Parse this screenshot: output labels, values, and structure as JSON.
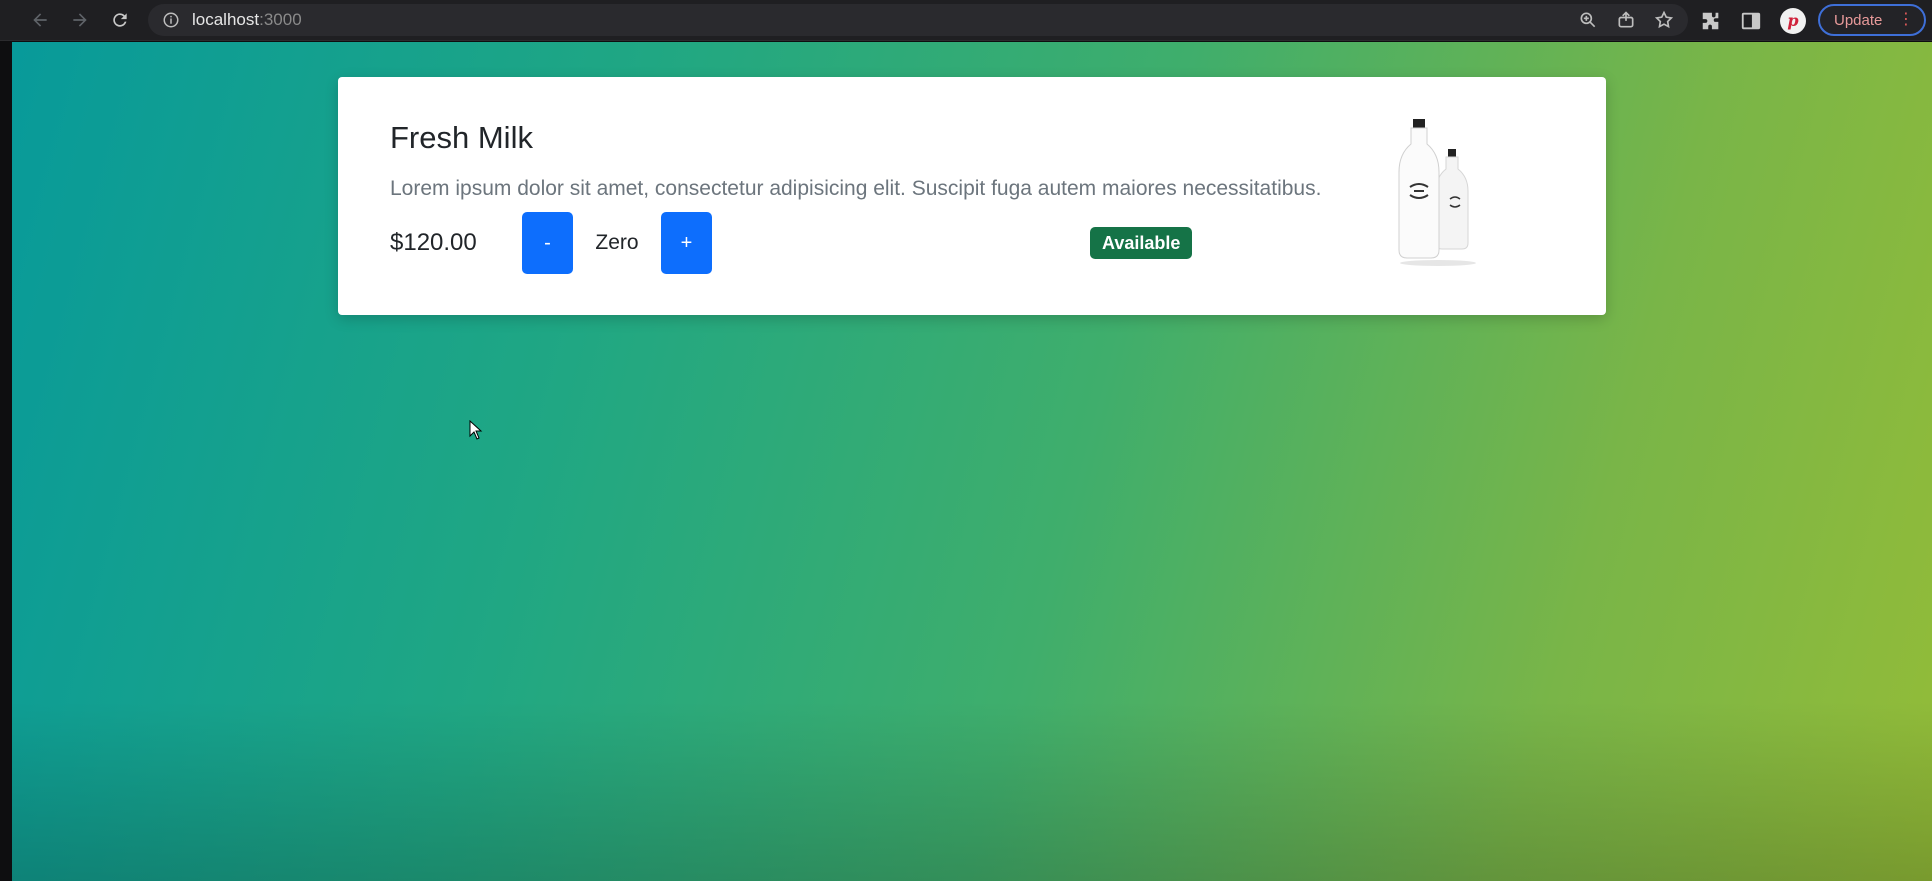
{
  "browser": {
    "url_host": "localhost",
    "url_port": ":3000",
    "update_label": "Update",
    "avatar_letter": "p",
    "icons": [
      "back-icon",
      "forward-icon",
      "reload-icon",
      "site-info-icon",
      "zoom-icon",
      "share-icon",
      "bookmark-star-icon",
      "extensions-icon",
      "side-panel-icon",
      "kebab-menu-icon"
    ]
  },
  "product": {
    "title": "Fresh Milk",
    "description": "Lorem ipsum dolor sit amet, consectetur adipisicing elit. Suscipit fuga autem maiores necessitatibus.",
    "price": "$120.00",
    "decrement_label": "-",
    "quantity": "Zero",
    "increment_label": "+",
    "status": "Available",
    "image_icon": "milk-bottles-image"
  },
  "colors": {
    "primary_button": "#0d6efd",
    "badge": "#157347",
    "gradient_start": "#089a9a",
    "gradient_end": "#93bc38"
  }
}
